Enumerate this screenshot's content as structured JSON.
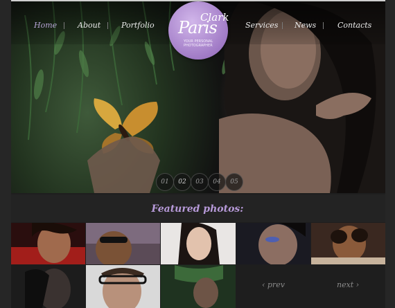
{
  "nav": {
    "home": "Home",
    "about": "About",
    "portfolio": "Portfolio",
    "services": "Services",
    "news": "News",
    "contacts": "Contacts"
  },
  "logo": {
    "first": "Paris",
    "last": "Clark",
    "tagline": "YOUR PERSONAL PHOTOGRAPHER"
  },
  "slider": {
    "pages": [
      "01",
      "02",
      "03",
      "04",
      "05"
    ],
    "active_index": 1
  },
  "featured": {
    "title": "Featured photos:",
    "prev": "‹ prev",
    "next": "next ›"
  },
  "colors": {
    "accent": "#b79ad9",
    "logo": "#a17bc6",
    "background": "#1e1e1e"
  }
}
